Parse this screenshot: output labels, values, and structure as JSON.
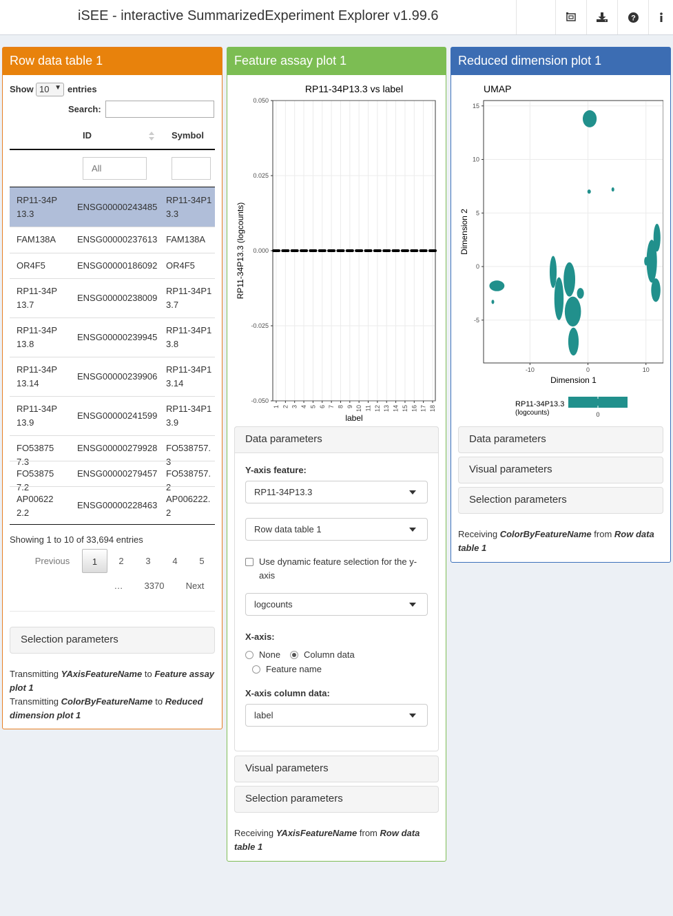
{
  "app": {
    "title": "iSEE - interactive SummarizedExperiment Explorer v1.99.6"
  },
  "nav_icons": [
    "screenshot-icon",
    "download-icon",
    "help-icon",
    "info-icon"
  ],
  "panels": {
    "row_table": {
      "title": "Row data table 1",
      "show_label": "Show",
      "entries_value": "10",
      "entries_label": "entries",
      "search_label": "Search:",
      "search_value": "",
      "columns": [
        "ID",
        "Symbol"
      ],
      "id_filter_placeholder": "All",
      "rows": [
        {
          "rowname": "RP11-34P13.3",
          "id": "ENSG00000243485",
          "symbol": "RP11-34P13.3",
          "selected": true
        },
        {
          "rowname": "FAM138A",
          "id": "ENSG00000237613",
          "symbol": "FAM138A"
        },
        {
          "rowname": "OR4F5",
          "id": "ENSG00000186092",
          "symbol": "OR4F5"
        },
        {
          "rowname": "RP11-34P13.7",
          "id": "ENSG00000238009",
          "symbol": "RP11-34P13.7"
        },
        {
          "rowname": "RP11-34P13.8",
          "id": "ENSG00000239945",
          "symbol": "RP11-34P13.8"
        },
        {
          "rowname": "RP11-34P13.14",
          "id": "ENSG00000239906",
          "symbol": "RP11-34P13.14"
        },
        {
          "rowname": "RP11-34P13.9",
          "id": "ENSG00000241599",
          "symbol": "RP11-34P13.9"
        },
        {
          "rowname": "FO538757.3",
          "id": "ENSG00000279928",
          "symbol": "FO538757.3"
        },
        {
          "rowname": "FO538757.2",
          "id": "ENSG00000279457",
          "symbol": "FO538757.2"
        },
        {
          "rowname": "AP006222.2",
          "id": "ENSG00000228463",
          "symbol": "AP006222.2"
        }
      ],
      "info": "Showing 1 to 10 of 33,694 entries",
      "pagination": {
        "previous": "Previous",
        "pages": [
          "1",
          "2",
          "3",
          "4",
          "5"
        ],
        "ellipsis": "…",
        "last": "3370",
        "next": "Next",
        "current": "1"
      },
      "selection_parameters": "Selection parameters",
      "transmit1_prefix": "Transmitting",
      "transmit1_field": "YAxisFeatureName",
      "transmit1_to": "to",
      "transmit1_target": "Feature assay plot 1",
      "transmit2_prefix": "Transmitting",
      "transmit2_field": "ColorByFeatureName",
      "transmit2_to": "to",
      "transmit2_target": "Reduced dimension plot 1"
    },
    "feature_assay": {
      "title": "Feature assay plot 1",
      "data_parameters": "Data parameters",
      "yaxis_feature_label": "Y-axis feature:",
      "yaxis_feature_value": "RP11-34P13.3",
      "source_value": "Row data table 1",
      "dynamic_checkbox_label": "Use dynamic feature selection for the y-axis",
      "dynamic_checked": false,
      "assay_value": "logcounts",
      "xaxis_label": "X-axis:",
      "xaxis_options": [
        "None",
        "Column data",
        "Feature name"
      ],
      "xaxis_selected": "Column data",
      "xaxis_coldata_label": "X-axis column data:",
      "xaxis_coldata_value": "label",
      "visual_parameters": "Visual parameters",
      "selection_parameters": "Selection parameters",
      "receive_prefix": "Receiving",
      "receive_field": "YAxisFeatureName",
      "receive_from": "from",
      "receive_source": "Row data table 1"
    },
    "reduced_dim": {
      "title": "Reduced dimension plot 1",
      "data_parameters": "Data parameters",
      "visual_parameters": "Visual parameters",
      "selection_parameters": "Selection parameters",
      "receive_prefix": "Receiving",
      "receive_field": "ColorByFeatureName",
      "receive_from": "from",
      "receive_source": "Row data table 1"
    }
  },
  "chart_data": [
    {
      "type": "scatter",
      "title": "RP11-34P13.3 vs label",
      "xlabel": "label",
      "ylabel": "RP11-34P13.3 (logcounts)",
      "categories": [
        "1",
        "2",
        "3",
        "4",
        "5",
        "6",
        "7",
        "8",
        "9",
        "10",
        "11",
        "12",
        "13",
        "14",
        "15",
        "16",
        "17",
        "18"
      ],
      "ylim": [
        -0.05,
        0.05
      ],
      "yticks": [
        "-0.050",
        "-0.025",
        "0.000",
        "0.025",
        "0.050"
      ],
      "values": [
        0,
        0,
        0,
        0,
        0,
        0,
        0,
        0,
        0,
        0,
        0,
        0,
        0,
        0,
        0,
        0,
        0,
        0
      ],
      "point_color": "#000000",
      "grid": true
    },
    {
      "type": "scatter",
      "title": "UMAP",
      "xlabel": "Dimension 1",
      "ylabel": "Dimension 2",
      "xlim": [
        -18,
        13
      ],
      "ylim": [
        -9,
        15.5
      ],
      "xticks": [
        "-10",
        "0",
        "10"
      ],
      "yticks": [
        "-5",
        "0",
        "5",
        "10",
        "15"
      ],
      "point_color": "#21908c",
      "legend_title": "RP11-34P13.3\n(logcounts)",
      "legend_title_lines": [
        "RP11-34P13.3",
        "(logcounts)"
      ],
      "legend_tick": "0",
      "legend_position": "bottom",
      "grid": true,
      "clusters": [
        {
          "x": 0.3,
          "y": 13.8,
          "rx": 1.2,
          "ry": 0.8
        },
        {
          "x": 0.2,
          "y": 7.0,
          "rx": 0.3,
          "ry": 0.2
        },
        {
          "x": 4.3,
          "y": 7.2,
          "rx": 0.2,
          "ry": 0.2
        },
        {
          "x": -15.7,
          "y": -1.8,
          "rx": 1.3,
          "ry": 0.5
        },
        {
          "x": -16.4,
          "y": -3.3,
          "rx": 0.2,
          "ry": 0.2
        },
        {
          "x": -6.0,
          "y": -0.5,
          "rx": 0.6,
          "ry": 1.5
        },
        {
          "x": -5.0,
          "y": -3.0,
          "rx": 0.8,
          "ry": 2.0
        },
        {
          "x": -3.2,
          "y": -1.2,
          "rx": 1.0,
          "ry": 1.6
        },
        {
          "x": -2.6,
          "y": -4.2,
          "rx": 1.4,
          "ry": 1.4
        },
        {
          "x": -2.5,
          "y": -7.0,
          "rx": 0.9,
          "ry": 1.3
        },
        {
          "x": -1.3,
          "y": -2.5,
          "rx": 0.6,
          "ry": 0.5
        },
        {
          "x": 11.0,
          "y": 0.5,
          "rx": 0.9,
          "ry": 2.0
        },
        {
          "x": 11.9,
          "y": 2.7,
          "rx": 0.6,
          "ry": 1.3
        },
        {
          "x": 11.7,
          "y": -2.2,
          "rx": 0.8,
          "ry": 1.1
        },
        {
          "x": 10.0,
          "y": 0.5,
          "rx": 0.3,
          "ry": 0.4
        }
      ]
    }
  ]
}
